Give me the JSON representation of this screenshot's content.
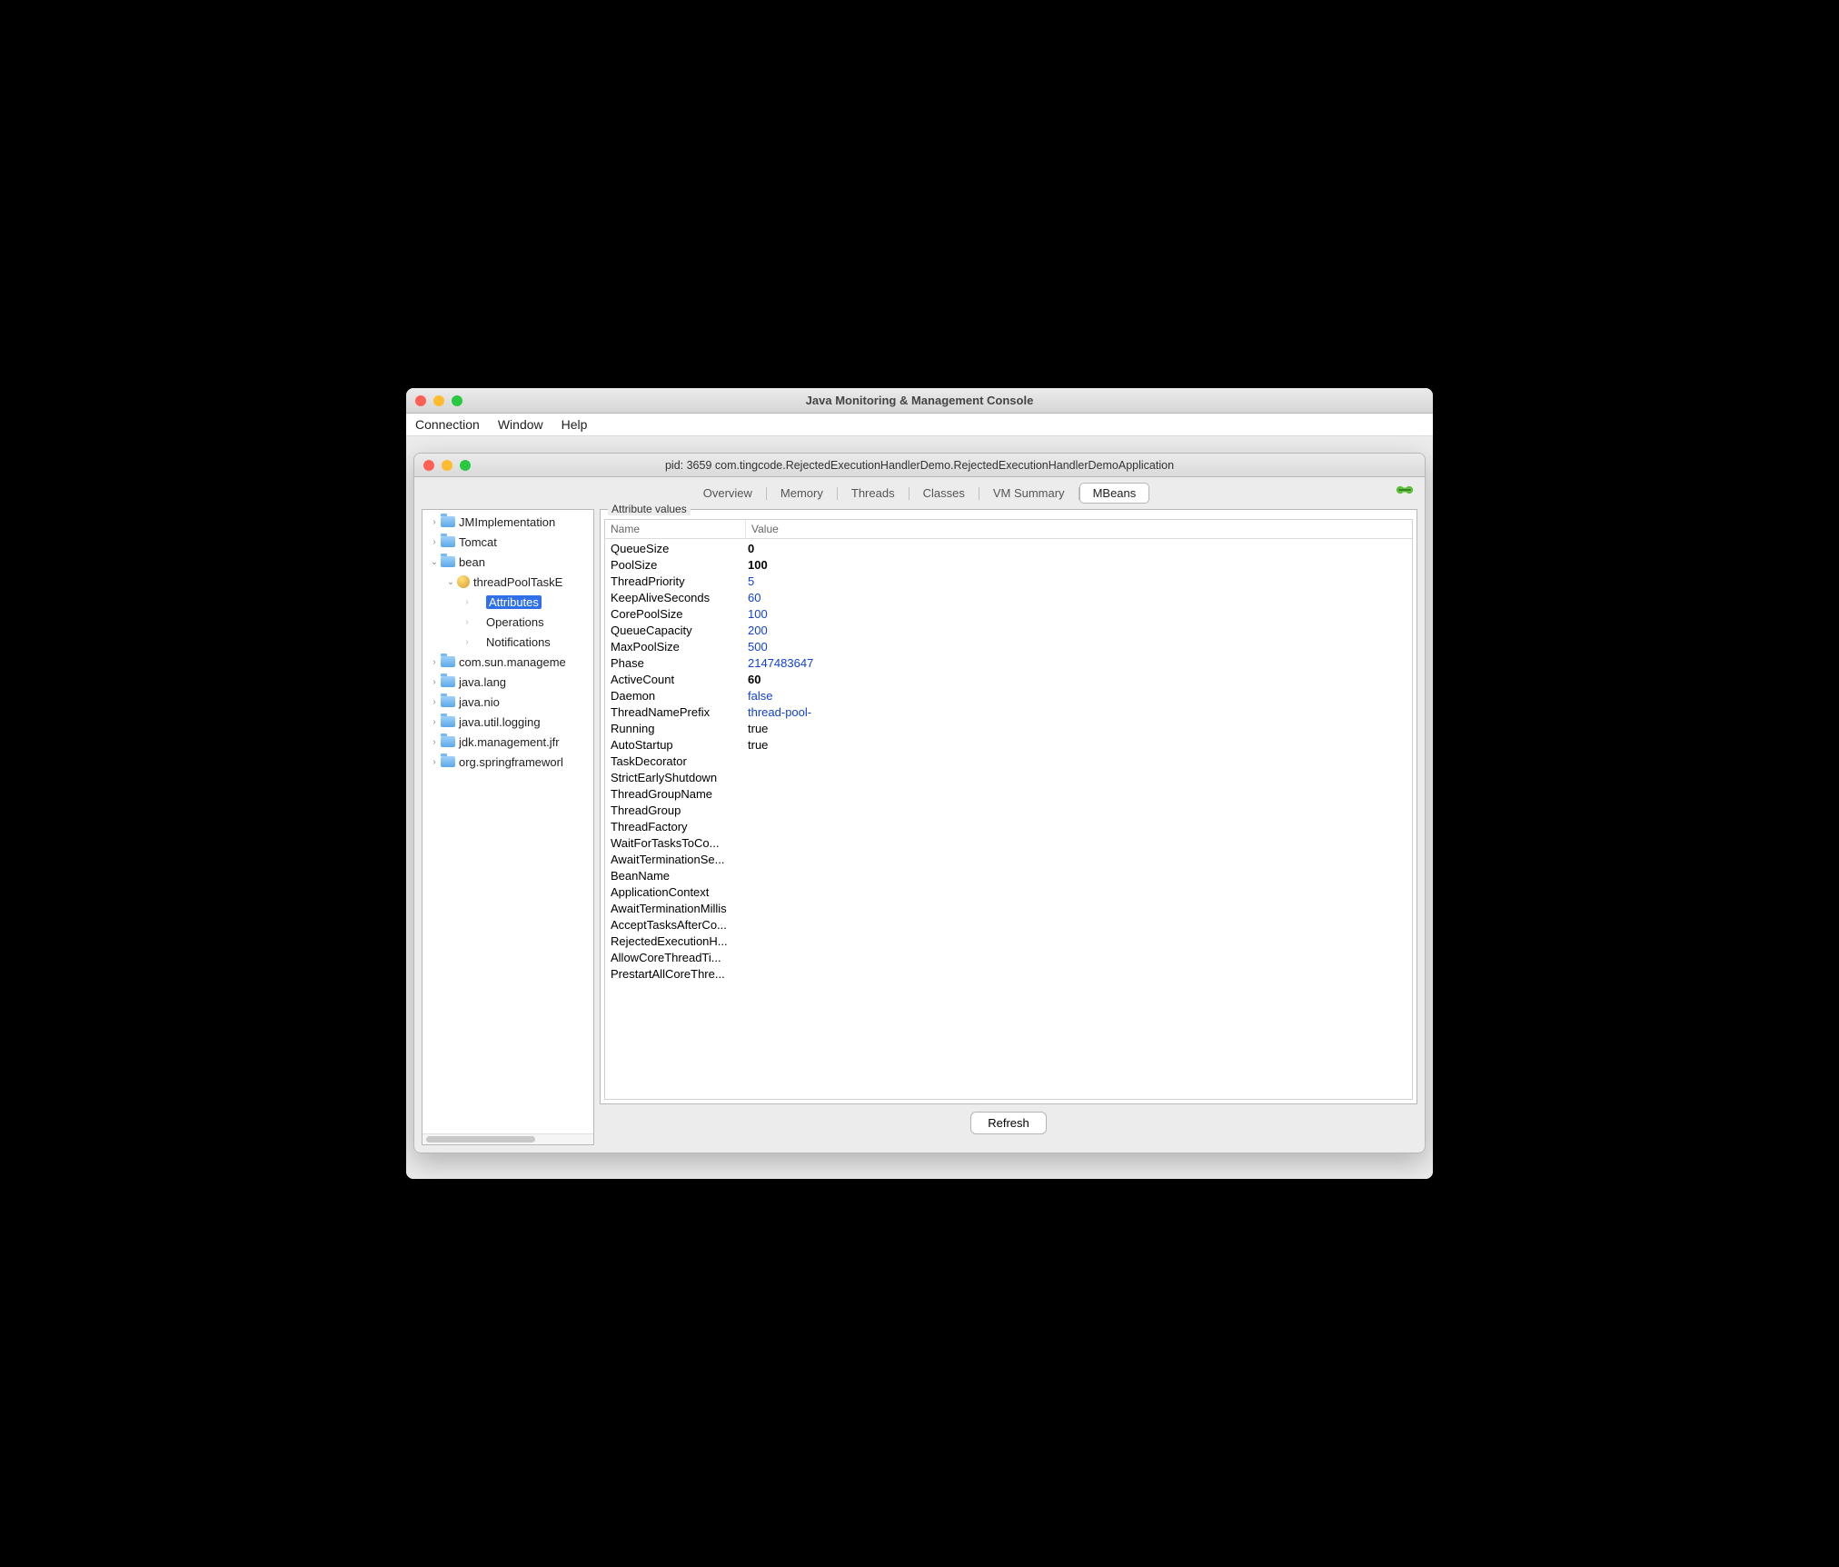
{
  "window": {
    "title": "Java Monitoring & Management Console"
  },
  "menubar": {
    "items": [
      "Connection",
      "Window",
      "Help"
    ]
  },
  "document": {
    "title": "pid: 3659 com.tingcode.RejectedExecutionHandlerDemo.RejectedExecutionHandlerDemoApplication"
  },
  "tabs": {
    "items": [
      "Overview",
      "Memory",
      "Threads",
      "Classes",
      "VM Summary",
      "MBeans"
    ],
    "active": "MBeans"
  },
  "tree": {
    "nodes": [
      {
        "label": "JMImplementation",
        "type": "folder",
        "level": 1,
        "expanded": false
      },
      {
        "label": "Tomcat",
        "type": "folder",
        "level": 1,
        "expanded": false
      },
      {
        "label": "bean",
        "type": "folder",
        "level": 1,
        "expanded": true
      },
      {
        "label": "threadPoolTaskE",
        "type": "bean",
        "level": 2,
        "expanded": true
      },
      {
        "label": "Attributes",
        "type": "leaf",
        "level": 3,
        "selected": true
      },
      {
        "label": "Operations",
        "type": "leaf",
        "level": 3
      },
      {
        "label": "Notifications",
        "type": "leaf",
        "level": 3
      },
      {
        "label": "com.sun.manageme",
        "type": "folder",
        "level": 1,
        "expanded": false
      },
      {
        "label": "java.lang",
        "type": "folder",
        "level": 1,
        "expanded": false
      },
      {
        "label": "java.nio",
        "type": "folder",
        "level": 1,
        "expanded": false
      },
      {
        "label": "java.util.logging",
        "type": "folder",
        "level": 1,
        "expanded": false
      },
      {
        "label": "jdk.management.jfr",
        "type": "folder",
        "level": 1,
        "expanded": false
      },
      {
        "label": "org.springframeworl",
        "type": "folder",
        "level": 1,
        "expanded": false
      }
    ]
  },
  "attributes": {
    "group_label": "Attribute values",
    "header": {
      "name": "Name",
      "value": "Value"
    },
    "rows": [
      {
        "name": "QueueSize",
        "value": "0",
        "style": "bold"
      },
      {
        "name": "PoolSize",
        "value": "100",
        "style": "bold"
      },
      {
        "name": "ThreadPriority",
        "value": "5",
        "style": "link"
      },
      {
        "name": "KeepAliveSeconds",
        "value": "60",
        "style": "link"
      },
      {
        "name": "CorePoolSize",
        "value": "100",
        "style": "link"
      },
      {
        "name": "QueueCapacity",
        "value": "200",
        "style": "link"
      },
      {
        "name": "MaxPoolSize",
        "value": "500",
        "style": "link"
      },
      {
        "name": "Phase",
        "value": "2147483647",
        "style": "link"
      },
      {
        "name": "ActiveCount",
        "value": "60",
        "style": "bold"
      },
      {
        "name": "Daemon",
        "value": "false",
        "style": "link"
      },
      {
        "name": "ThreadNamePrefix",
        "value": "thread-pool-",
        "style": "link"
      },
      {
        "name": "Running",
        "value": "true",
        "style": "plain"
      },
      {
        "name": "AutoStartup",
        "value": "true",
        "style": "plain"
      },
      {
        "name": "TaskDecorator",
        "value": "",
        "style": "plain"
      },
      {
        "name": "StrictEarlyShutdown",
        "value": "",
        "style": "plain"
      },
      {
        "name": "ThreadGroupName",
        "value": "",
        "style": "plain"
      },
      {
        "name": "ThreadGroup",
        "value": "",
        "style": "plain"
      },
      {
        "name": "ThreadFactory",
        "value": "",
        "style": "plain"
      },
      {
        "name": "WaitForTasksToCo...",
        "value": "",
        "style": "plain"
      },
      {
        "name": "AwaitTerminationSe...",
        "value": "",
        "style": "plain"
      },
      {
        "name": "BeanName",
        "value": "",
        "style": "plain"
      },
      {
        "name": "ApplicationContext",
        "value": "",
        "style": "plain"
      },
      {
        "name": "AwaitTerminationMillis",
        "value": "",
        "style": "plain"
      },
      {
        "name": "AcceptTasksAfterCo...",
        "value": "",
        "style": "plain"
      },
      {
        "name": "RejectedExecutionH...",
        "value": "",
        "style": "plain"
      },
      {
        "name": "AllowCoreThreadTi...",
        "value": "",
        "style": "plain"
      },
      {
        "name": "PrestartAllCoreThre...",
        "value": "",
        "style": "plain"
      }
    ]
  },
  "refresh": {
    "label": "Refresh"
  }
}
